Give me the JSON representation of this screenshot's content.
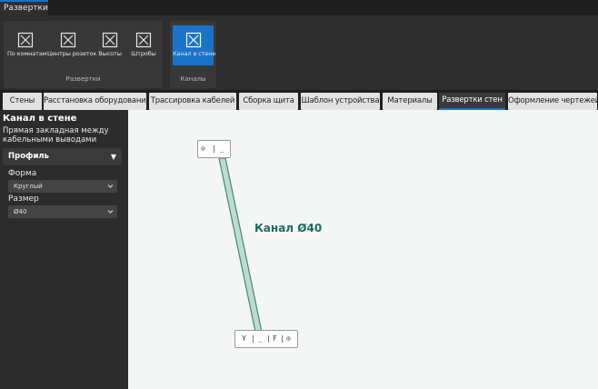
{
  "ribbon": {
    "tab": "Развертки",
    "groups": {
      "razvertki": {
        "label": "Развертки",
        "buttons": [
          "По комнатам",
          "Центры розеток",
          "Высоты",
          "Штробы"
        ]
      },
      "kanaly": {
        "label": "Каналы",
        "buttons": [
          "Канал в стене"
        ]
      }
    },
    "accent": "#1a73c8"
  },
  "tabs": [
    "Стены",
    "Расстановка оборудования",
    "Трассировка кабелей",
    "Сборка щита",
    "Шаблон устройства",
    "Материалы",
    "Развертки стен",
    "Оформление чертежей"
  ],
  "active_tab": "Развертки стен",
  "panel": {
    "title": "Канал в стене",
    "subtitle": "Прямая закладная между кабельными выводами",
    "section": "Профиль",
    "section_arrow": "▼",
    "form_label": "Форма",
    "form_value": "Круглый",
    "size_label": "Размер",
    "size_value": "Ø40"
  },
  "canvas": {
    "channel_label": "Канал Ø40",
    "top_cap": [
      "⊙",
      "|",
      "_"
    ],
    "bottom_cap": [
      "Y",
      "|",
      "_",
      "|",
      "F",
      "|",
      "⊙"
    ],
    "channel_color": "#bcdccf",
    "channel_stroke": "#3d8a74"
  }
}
